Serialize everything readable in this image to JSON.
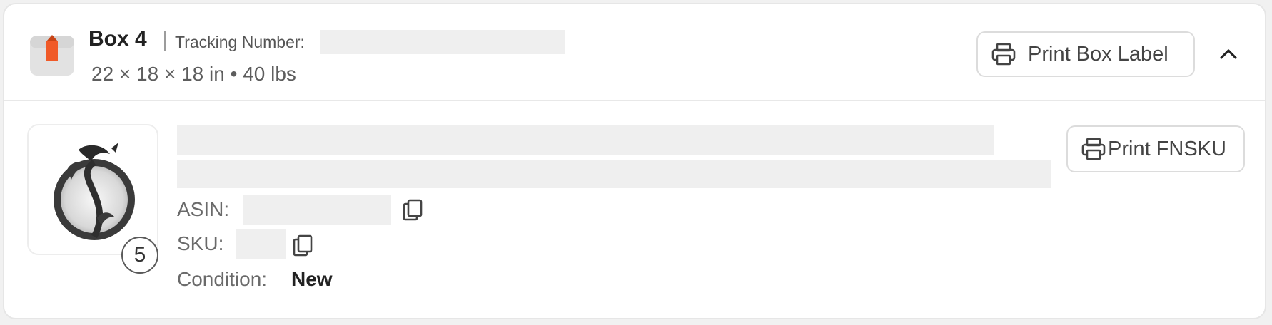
{
  "box": {
    "title": "Box 4",
    "tracking_label": "Tracking Number:",
    "dimensions": "22 × 18 × 18 in • 40 lbs",
    "print_label": "Print Box Label"
  },
  "item": {
    "quantity": "5",
    "asin_label": "ASIN:",
    "sku_label": "SKU:",
    "condition_label": "Condition:",
    "condition_value": "New",
    "print_fnsku_label": "Print FNSKU"
  },
  "colors": {
    "box_icon_accent": "#f05a28",
    "redaction": "#efefef"
  },
  "icons": {
    "box": "package-icon",
    "print": "printer-icon",
    "collapse": "chevron-up-icon",
    "copy": "copy-icon"
  }
}
